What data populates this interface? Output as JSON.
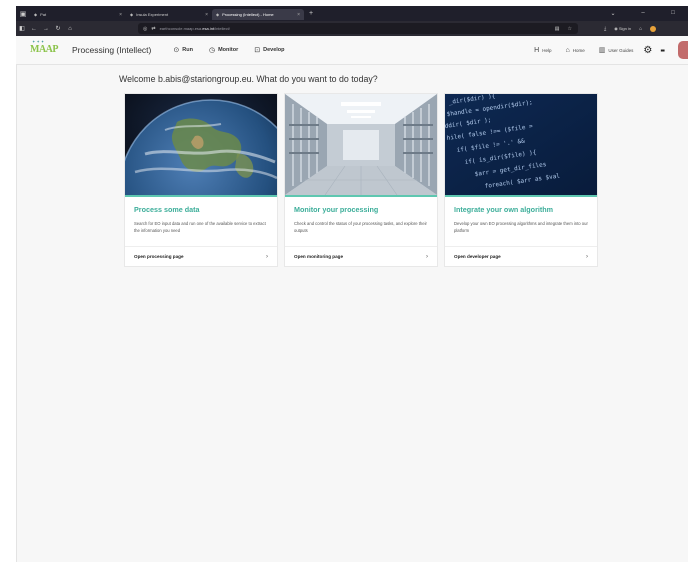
{
  "browser": {
    "tabs": [
      {
        "label": "Pat",
        "active": false
      },
      {
        "label": "Insula Experiment",
        "active": false
      },
      {
        "label": "Processing (Intellect) - Home",
        "active": true
      }
    ],
    "url_prefix": "earthconsole.maap.esa.",
    "url_host": "esa.int",
    "url_path": "/intellect/",
    "sign_in": "Sign in"
  },
  "header": {
    "app_title": "Processing (Intellect)",
    "nav": [
      {
        "label": "Run",
        "icon": "play-circle-icon",
        "glyph": "⊙"
      },
      {
        "label": "Monitor",
        "icon": "gauge-icon",
        "glyph": "◷"
      },
      {
        "label": "Develop",
        "icon": "terminal-icon",
        "glyph": "⊡"
      }
    ],
    "right": [
      {
        "label": "Help",
        "icon": "help-icon",
        "glyph": "H"
      },
      {
        "label": "Home",
        "icon": "home-icon",
        "glyph": "⌂"
      },
      {
        "label": "User Guides",
        "icon": "book-icon",
        "glyph": "▥"
      }
    ]
  },
  "main": {
    "welcome": "Welcome b.abis@stariongroup.eu. What do you want to do today?",
    "cards": [
      {
        "title": "Process some data",
        "description": "Search for EO input data and run one of the available service to extract the information you need",
        "link": "Open processing page",
        "image": "earth-globe"
      },
      {
        "title": "Monitor your processing",
        "description": "Check and control the status of your processing tasks, and explore their outputs",
        "link": "Open monitoring page",
        "image": "server-room"
      },
      {
        "title": "Integrate your own algorithm",
        "description": "Develop your own EO processing algorithms and integrate them into our platform",
        "link": "Open developer page",
        "image": "code-screen"
      }
    ]
  },
  "colors": {
    "accent": "#3dae9a",
    "accent_bar": "#5ec7b0",
    "logo_green": "#8bc34a"
  }
}
